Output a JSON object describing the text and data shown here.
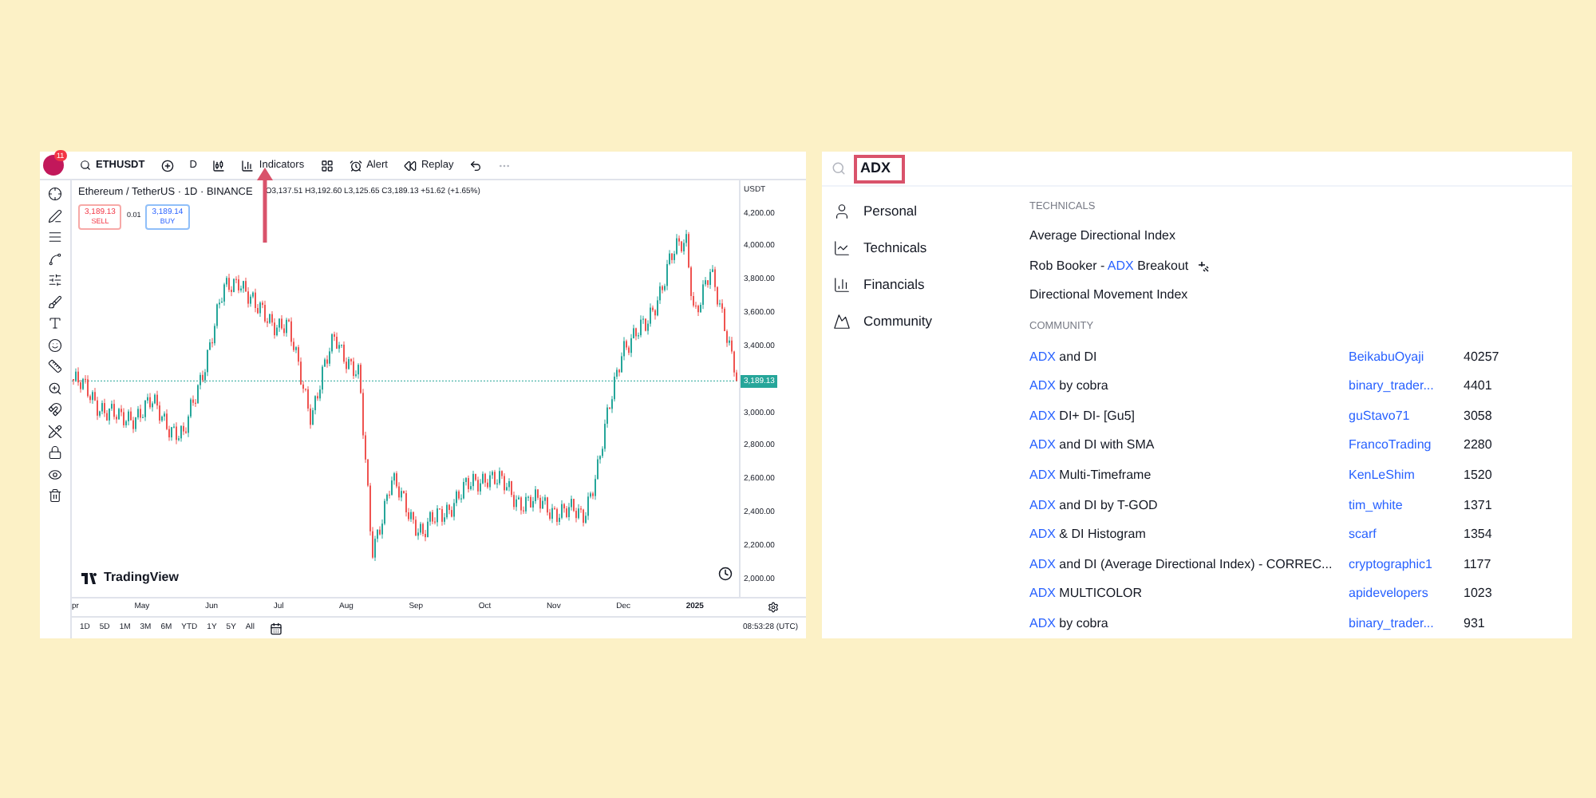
{
  "chart_panel": {
    "toolbar": {
      "badge": "11",
      "symbol": "ETHUSDT",
      "interval": "D",
      "indicators": "Indicators",
      "alert": "Alert",
      "replay": "Replay"
    },
    "legend": {
      "title": "Ethereum / TetherUS · 1D · BINANCE",
      "ohlc": "O3,137.51 H3,192.60 L3,125.65 C3,189.13 +51.62 (+1.65%)",
      "sell_price": "3,189.13",
      "sell_label": "SELL",
      "spread": "0.01",
      "buy_price": "3,189.14",
      "buy_label": "BUY"
    },
    "currency": "USDT",
    "price_axis": [
      {
        "kind": "tick",
        "label": "4,200.00"
      },
      {
        "kind": "tick",
        "label": "4,000.00"
      },
      {
        "kind": "tick",
        "label": "3,800.00"
      },
      {
        "kind": "tick",
        "label": "3,600.00"
      },
      {
        "kind": "tick",
        "label": "3,400.00"
      },
      {
        "kind": "tag",
        "label": "3,189.13"
      },
      {
        "kind": "tick",
        "label": "3,000.00"
      },
      {
        "kind": "tick",
        "label": "2,800.00"
      },
      {
        "kind": "tick",
        "label": "2,600.00"
      },
      {
        "kind": "tick",
        "label": "2,400.00"
      },
      {
        "kind": "tick",
        "label": "2,200.00"
      },
      {
        "kind": "tick",
        "label": "2,000.00"
      }
    ],
    "logo": "TradingView",
    "time_axis": [
      "pr",
      "May",
      "Jun",
      "Jul",
      "Aug",
      "Sep",
      "Oct",
      "Nov",
      "Dec",
      "2025"
    ],
    "ranges": [
      "1D",
      "5D",
      "1M",
      "3M",
      "6M",
      "YTD",
      "1Y",
      "5Y",
      "All"
    ],
    "clock": "08:53:28 (UTC)"
  },
  "search_panel": {
    "query": "ADX",
    "categories": [
      {
        "label": "Personal",
        "kind": "person"
      },
      {
        "label": "Technicals",
        "kind": "chart"
      },
      {
        "label": "Financials",
        "kind": "bars"
      },
      {
        "label": "Community",
        "kind": "mountain"
      }
    ],
    "technicals": {
      "heading": "TECHNICALS",
      "items": [
        {
          "parts": [
            {
              "text": "Average Directional Index",
              "highlight": false
            }
          ],
          "badge": false
        },
        {
          "parts": [
            {
              "text": "Rob Booker - ",
              "highlight": false
            },
            {
              "text": "ADX",
              "highlight": true
            },
            {
              "text": " Breakout",
              "highlight": false
            }
          ],
          "badge": true
        },
        {
          "parts": [
            {
              "text": "Directional Movement Index",
              "highlight": false
            }
          ],
          "badge": false
        }
      ]
    },
    "community": {
      "heading": "COMMUNITY",
      "items": [
        {
          "parts": [
            {
              "text": "ADX",
              "highlight": true
            },
            {
              "text": " and DI",
              "highlight": false
            }
          ],
          "author": "BeikabuOyaji",
          "count": "40257"
        },
        {
          "parts": [
            {
              "text": "ADX",
              "highlight": true
            },
            {
              "text": " by cobra",
              "highlight": false
            }
          ],
          "author": "binary_trader...",
          "count": "4401"
        },
        {
          "parts": [
            {
              "text": "ADX",
              "highlight": true
            },
            {
              "text": " DI+ DI- [Gu5]",
              "highlight": false
            }
          ],
          "author": "guStavo71",
          "count": "3058"
        },
        {
          "parts": [
            {
              "text": "ADX",
              "highlight": true
            },
            {
              "text": " and DI with SMA",
              "highlight": false
            }
          ],
          "author": "FrancoTrading",
          "count": "2280"
        },
        {
          "parts": [
            {
              "text": "ADX",
              "highlight": true
            },
            {
              "text": " Multi-Timeframe",
              "highlight": false
            }
          ],
          "author": "KenLeShim",
          "count": "1520"
        },
        {
          "parts": [
            {
              "text": "ADX",
              "highlight": true
            },
            {
              "text": " and DI by T-GOD",
              "highlight": false
            }
          ],
          "author": "tim_white",
          "count": "1371"
        },
        {
          "parts": [
            {
              "text": "ADX",
              "highlight": true
            },
            {
              "text": " & DI Histogram",
              "highlight": false
            }
          ],
          "author": "scarf",
          "count": "1354"
        },
        {
          "parts": [
            {
              "text": "ADX",
              "highlight": true
            },
            {
              "text": " and DI (Average Directional Index) - CORREC...",
              "highlight": false
            }
          ],
          "author": "cryptographic1",
          "count": "1177"
        },
        {
          "parts": [
            {
              "text": "ADX",
              "highlight": true
            },
            {
              "text": " MULTICOLOR",
              "highlight": false
            }
          ],
          "author": "apidevelopers",
          "count": "1023"
        },
        {
          "parts": [
            {
              "text": "ADX",
              "highlight": true
            },
            {
              "text": " by cobra",
              "highlight": false
            }
          ],
          "author": "binary_trader...",
          "count": "931"
        }
      ]
    }
  }
}
